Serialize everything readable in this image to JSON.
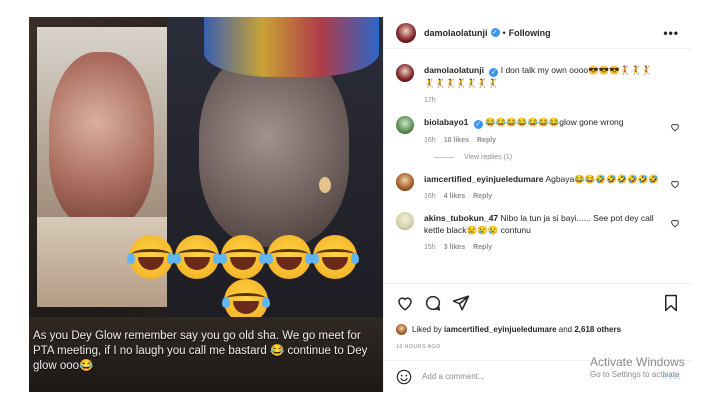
{
  "header": {
    "username": "damolaolatunji",
    "separator": "•",
    "follow_state": "Following",
    "more": "•••"
  },
  "media": {
    "caption": "As you Dey Glow remember say you go old sha. We go meet for PTA meeting, if I no laugh you call me bastard 😂 continue to Dey glow ooo😂"
  },
  "caption_comment": {
    "username": "damolaolatunji",
    "text": "I don talk my own oooo😎😎😎🤾🤾🤾🤾🤾🤾🤾🤾🤾🤾",
    "time": "17h"
  },
  "comments": [
    {
      "username": "biolabayo1",
      "verified": true,
      "text": "😂😂😂😂😂😂😂glow gone wrong",
      "time": "16h",
      "likes": "10 likes",
      "reply": "Reply",
      "view_replies": "View replies (1)"
    },
    {
      "username": "iamcertified_eyinjueledumare",
      "verified": false,
      "text": "Agbaya😂😂🤣🤣🤣🤣🤣🤣",
      "time": "16h",
      "likes": "4 likes",
      "reply": "Reply"
    },
    {
      "username": "akins_tubokun_47",
      "verified": false,
      "text": "Nibo la tun ja si bayi...... See pot dey call kettle black😢😢😢 contunu",
      "time": "15h",
      "likes": "3 likes",
      "reply": "Reply"
    }
  ],
  "likes": {
    "prefix": "Liked by",
    "user": "iamcertified_eyinjueledumare",
    "and": "and",
    "others": "2,618 others"
  },
  "posted_ago": "16 HOURS AGO",
  "add_comment": {
    "placeholder": "Add a comment...",
    "post": "Post"
  },
  "watermark": {
    "line1": "Activate Windows",
    "line2": "Go to Settings to activate"
  },
  "icons": {
    "more": "more-options-icon",
    "heart": "heart-icon",
    "comment": "comment-icon",
    "share": "share-icon",
    "save": "bookmark-icon",
    "emoji": "emoji-icon",
    "verified": "verified-icon"
  },
  "colors": {
    "link_blue": "#3897f0",
    "muted": "#8e8e8e",
    "text": "#262626",
    "post_disabled": "#b2dffc"
  }
}
